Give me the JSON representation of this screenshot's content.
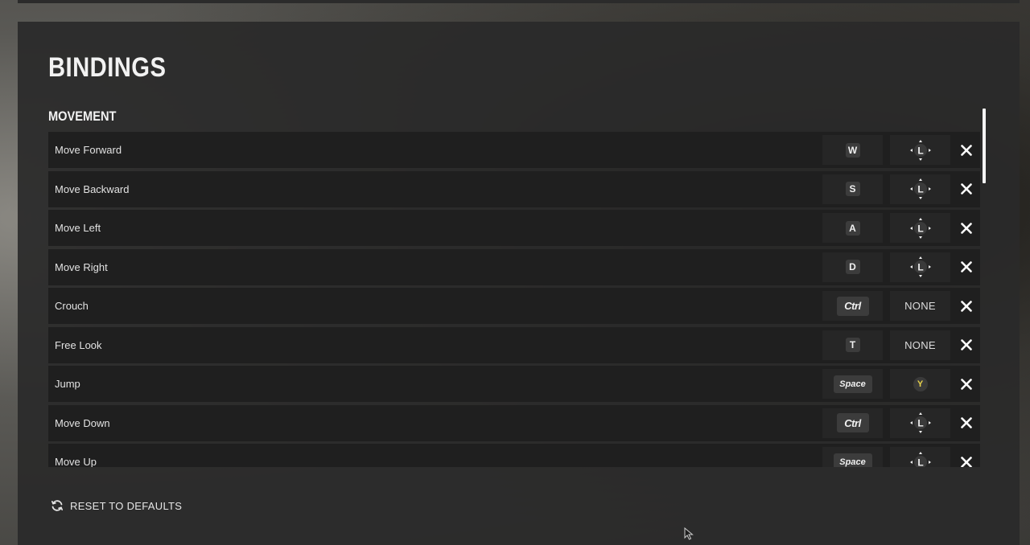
{
  "panel": {
    "title": "BINDINGS",
    "section_title": "MOVEMENT"
  },
  "bindings": [
    {
      "action": "Move Forward",
      "keyboard": "W",
      "keyboard_style": "small",
      "gamepad": "left-stick-icon"
    },
    {
      "action": "Move Backward",
      "keyboard": "S",
      "keyboard_style": "small",
      "gamepad": "left-stick-icon"
    },
    {
      "action": "Move Left",
      "keyboard": "A",
      "keyboard_style": "small",
      "gamepad": "left-stick-icon"
    },
    {
      "action": "Move Right",
      "keyboard": "D",
      "keyboard_style": "small",
      "gamepad": "left-stick-icon"
    },
    {
      "action": "Crouch",
      "keyboard": "Ctrl",
      "keyboard_style": "wide",
      "gamepad": "NONE"
    },
    {
      "action": "Free Look",
      "keyboard": "T",
      "keyboard_style": "small",
      "gamepad": "NONE"
    },
    {
      "action": "Jump",
      "keyboard": "Space",
      "keyboard_style": "space",
      "gamepad": "Y"
    },
    {
      "action": "Move Down",
      "keyboard": "Ctrl",
      "keyboard_style": "wide",
      "gamepad": "left-stick-icon"
    },
    {
      "action": "Move Up",
      "keyboard": "Space",
      "keyboard_style": "space",
      "gamepad": "left-stick-icon"
    }
  ],
  "reset": {
    "label": "RESET TO DEFAULTS",
    "icon": "refresh-icon"
  },
  "icons": {
    "clear": "close-icon",
    "stick": "left-stick-icon",
    "stick_letter": "L"
  },
  "colors": {
    "panel_bg": "#2a2a2a",
    "row_bg": "#1f1f1f",
    "slot_bg": "#262626",
    "key_bg": "#3c3c3c",
    "gamepad_y": "#e8d24a",
    "text": "#e6e6e6"
  }
}
